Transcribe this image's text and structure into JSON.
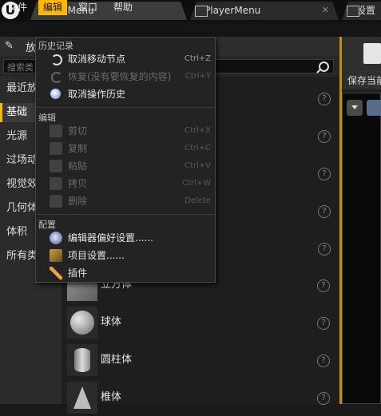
{
  "tabs": [
    {
      "label": "MainMenu"
    },
    {
      "label": "PlayerMenu",
      "close": "✕"
    },
    {
      "label": "设置"
    }
  ],
  "menubar": [
    "文件",
    "编辑",
    "窗口",
    "帮助"
  ],
  "left_panel": {
    "place_title": "放",
    "search_placeholder": "搜索类",
    "categories": [
      "最近放",
      "基础",
      "光源",
      "过场动",
      "视觉效",
      "几何体",
      "体积",
      "所有类"
    ],
    "items": [
      {
        "label": "立方体"
      },
      {
        "label": "球体"
      },
      {
        "label": "圆柱体"
      },
      {
        "label": "椎体"
      }
    ],
    "help_glyph": "?"
  },
  "right_panel": {
    "save_label": "保存当前"
  },
  "edit_menu": {
    "sections": [
      {
        "title": "历史记录",
        "items": [
          {
            "label": "取消移动节点",
            "shortcut": "Ctrl+Z",
            "enabled": true,
            "icon": "undo-icon"
          },
          {
            "label": "恢复(没有要恢复的内容)",
            "shortcut": "Ctrl+Y",
            "enabled": false,
            "icon": "redo-icon"
          },
          {
            "label": "取消操作历史",
            "shortcut": "",
            "enabled": true,
            "icon": "history-icon"
          }
        ]
      },
      {
        "title": "编辑",
        "items": [
          {
            "label": "剪切",
            "shortcut": "Ctrl+X",
            "enabled": false,
            "icon": "cut-icon"
          },
          {
            "label": "复制",
            "shortcut": "Ctrl+C",
            "enabled": false,
            "icon": "copy-icon"
          },
          {
            "label": "粘贴",
            "shortcut": "Ctrl+V",
            "enabled": false,
            "icon": "paste-icon"
          },
          {
            "label": "拷贝",
            "shortcut": "Ctrl+W",
            "enabled": false,
            "icon": "duplicate-icon"
          },
          {
            "label": "删除",
            "shortcut": "Delete",
            "enabled": false,
            "icon": "delete-icon"
          }
        ]
      },
      {
        "title": "配置",
        "items": [
          {
            "label": "编辑器偏好设置......",
            "shortcut": "",
            "enabled": true,
            "icon": "editor-preferences-icon"
          },
          {
            "label": "项目设置......",
            "shortcut": "",
            "enabled": true,
            "icon": "project-settings-icon"
          },
          {
            "label": "插件",
            "shortcut": "",
            "enabled": true,
            "icon": "plugin-icon"
          }
        ]
      }
    ]
  },
  "colors": {
    "accent": "#ffb800",
    "menu_bg": "#232323",
    "panel_bg": "#262626"
  }
}
